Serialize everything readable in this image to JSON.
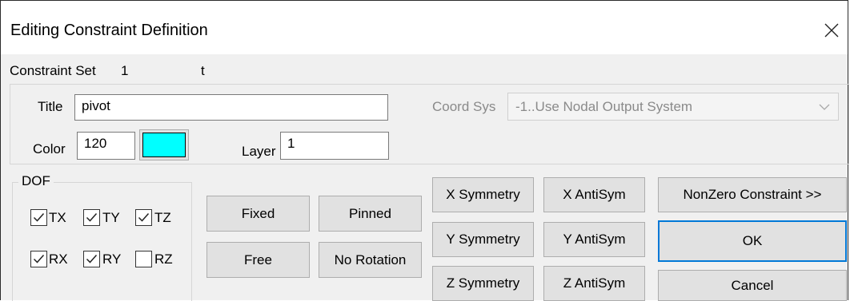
{
  "window": {
    "title": "Editing Constraint Definition"
  },
  "constraint_set": {
    "label": "Constraint Set",
    "id": "1",
    "name": "t"
  },
  "title_field": {
    "label": "Title",
    "value": "pivot"
  },
  "coord_sys": {
    "label": "Coord Sys",
    "value": "-1..Use Nodal Output System"
  },
  "color_field": {
    "label": "Color",
    "value": "120",
    "swatch": "#00ffff"
  },
  "layer_field": {
    "label": "Layer",
    "value": "1"
  },
  "dof": {
    "label": "DOF",
    "items": [
      {
        "label": "TX",
        "checked": true
      },
      {
        "label": "TY",
        "checked": true
      },
      {
        "label": "TZ",
        "checked": true
      },
      {
        "label": "RX",
        "checked": true
      },
      {
        "label": "RY",
        "checked": true
      },
      {
        "label": "RZ",
        "checked": false
      }
    ]
  },
  "buttons": {
    "fixed": "Fixed",
    "pinned": "Pinned",
    "free": "Free",
    "no_rotation": "No Rotation",
    "x_symmetry": "X Symmetry",
    "y_symmetry": "Y Symmetry",
    "z_symmetry": "Z Symmetry",
    "x_antisym": "X AntiSym",
    "y_antisym": "Y AntiSym",
    "z_antisym": "Z AntiSym",
    "nonzero": "NonZero Constraint >>",
    "ok": "OK",
    "cancel": "Cancel"
  },
  "colors": {
    "accent": "#0078d7",
    "dialog_bg": "#f0f0f0",
    "button_bg": "#e1e1e1"
  }
}
